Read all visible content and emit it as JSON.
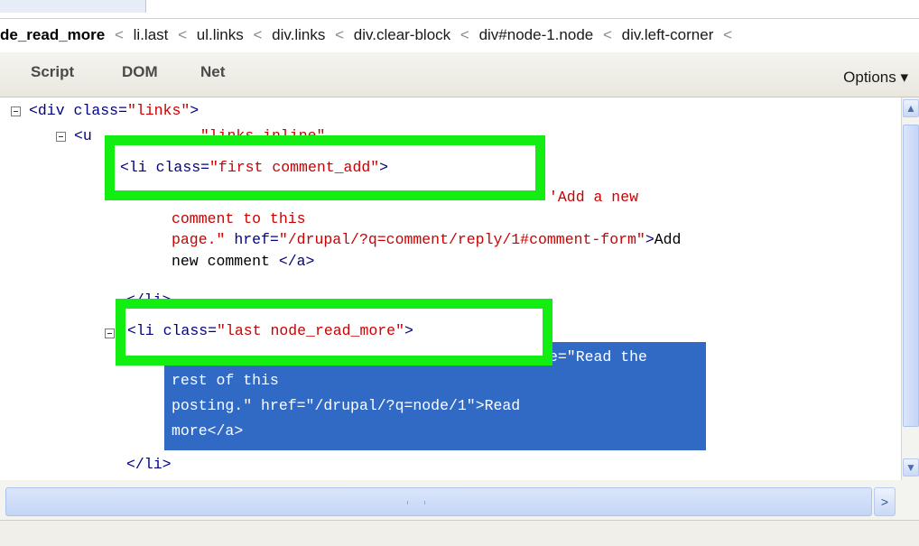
{
  "breadcrumb": {
    "current": "de_read_more",
    "items": [
      "li.last",
      "ul.links",
      "div.links",
      "div.clear-block",
      "div#node-1.node",
      "div.left-corner",
      "<"
    ],
    "separator": "<"
  },
  "toolbar": {
    "tabs": [
      "Script",
      "DOM",
      "Net"
    ],
    "options_label": "Options ▾"
  },
  "tree": {
    "div_open": {
      "tag": "<div ",
      "attr": "class=",
      "val": "\"links\"",
      "close": ">"
    },
    "ul_partial": {
      "tag": "<u",
      "val": "\"links inline\""
    },
    "li_first": {
      "tag": "<li ",
      "attr": "class=",
      "val": "\"first comment_add\"",
      "close": ">"
    },
    "a_first_end": {
      "val": "'Add a new"
    },
    "a_first_2": {
      "val": "comment to this"
    },
    "a_first_3": {
      "val": "page.\"",
      "attr": " href=",
      "href": "\"/drupal/?q=comment/reply/1#comment-form\"",
      "close": ">",
      "text": "Add"
    },
    "a_first_4": {
      "text": "new comment",
      "tag": "</a>"
    },
    "li_first_close": {
      "tag": "</li>"
    },
    "li_last": {
      "tag": "<li ",
      "attr": "class=",
      "val": "\"last node_read_more\"",
      "close": ">"
    },
    "a_last_1": {
      "val": "e=\"Read the"
    },
    "a_last_2": {
      "val": "rest of this"
    },
    "a_last_3": {
      "val": "posting.\"",
      "attr": " href=",
      "href": "\"/drupal/?q=node/1\"",
      "close": ">",
      "text": "Read"
    },
    "a_last_4": {
      "text": "more",
      "tag": "</a>"
    },
    "li_last_close": {
      "tag": "</li>"
    }
  },
  "colors": {
    "highlight": "#316ac5",
    "annotation_box": "#12ee12",
    "tag": "#000080",
    "value": "#cc0000"
  },
  "scrollbars": {
    "up_arrow": "▲",
    "down_arrow": "▼",
    "right_arrow": ">"
  }
}
